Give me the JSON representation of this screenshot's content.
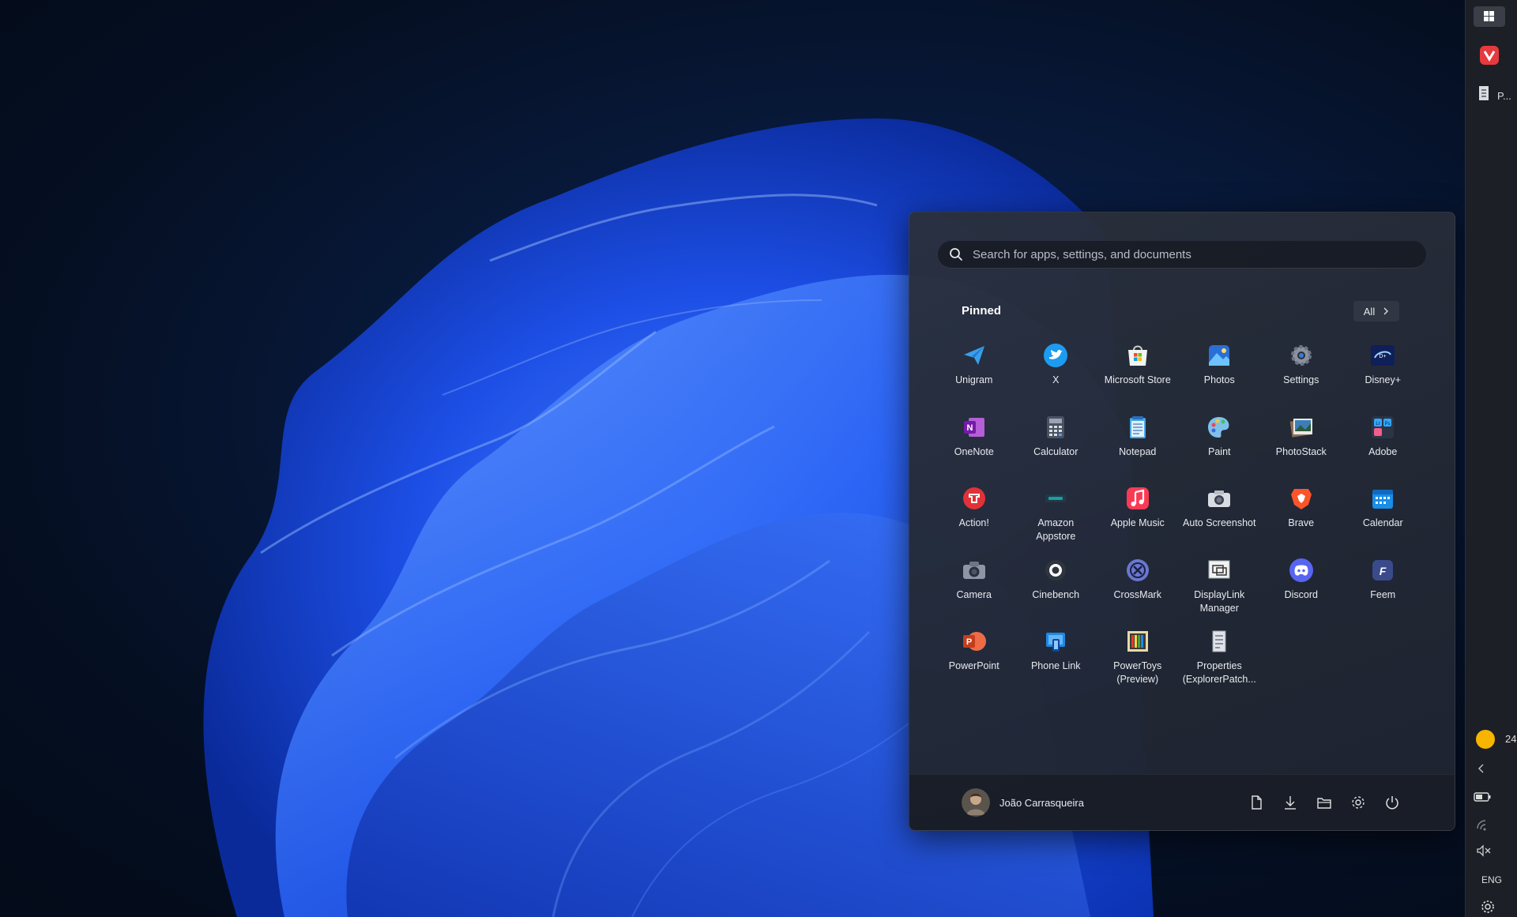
{
  "start_menu": {
    "search": {
      "placeholder": "Search for apps, settings, and documents"
    },
    "pinned_label": "Pinned",
    "all_button_label": "All",
    "apps": [
      {
        "id": "unigram",
        "label": "Unigram",
        "icon": "unigram-icon"
      },
      {
        "id": "x",
        "label": "X",
        "icon": "x-twitter-icon"
      },
      {
        "id": "microsoft-store",
        "label": "Microsoft Store",
        "icon": "microsoft-store-icon"
      },
      {
        "id": "photos",
        "label": "Photos",
        "icon": "photos-icon"
      },
      {
        "id": "settings",
        "label": "Settings",
        "icon": "settings-gear-icon"
      },
      {
        "id": "disney",
        "label": "Disney+",
        "icon": "disney-plus-icon"
      },
      {
        "id": "onenote",
        "label": "OneNote",
        "icon": "onenote-icon"
      },
      {
        "id": "calculator",
        "label": "Calculator",
        "icon": "calculator-icon"
      },
      {
        "id": "notepad",
        "label": "Notepad",
        "icon": "notepad-icon"
      },
      {
        "id": "paint",
        "label": "Paint",
        "icon": "paint-palette-icon"
      },
      {
        "id": "photostack",
        "label": "PhotoStack",
        "icon": "photostack-icon"
      },
      {
        "id": "adobe",
        "label": "Adobe",
        "icon": "adobe-folder-icon"
      },
      {
        "id": "action",
        "label": "Action!",
        "icon": "action-icon"
      },
      {
        "id": "amazon-appstore",
        "label": "Amazon\nAppstore",
        "icon": "amazon-appstore-icon"
      },
      {
        "id": "apple-music",
        "label": "Apple Music",
        "icon": "apple-music-icon"
      },
      {
        "id": "auto-screenshot",
        "label": "Auto Screenshot",
        "icon": "camera-screenshot-icon"
      },
      {
        "id": "brave",
        "label": "Brave",
        "icon": "brave-lion-icon"
      },
      {
        "id": "calendar",
        "label": "Calendar",
        "icon": "calendar-icon"
      },
      {
        "id": "camera",
        "label": "Camera",
        "icon": "camera-icon"
      },
      {
        "id": "cinebench",
        "label": "Cinebench",
        "icon": "cinebench-icon"
      },
      {
        "id": "crossmark",
        "label": "CrossMark",
        "icon": "crossmark-icon"
      },
      {
        "id": "displaylink",
        "label": "DisplayLink\nManager",
        "icon": "displaylink-icon"
      },
      {
        "id": "discord",
        "label": "Discord",
        "icon": "discord-icon"
      },
      {
        "id": "feem",
        "label": "Feem",
        "icon": "feem-icon"
      },
      {
        "id": "powerpoint",
        "label": "PowerPoint",
        "icon": "powerpoint-icon"
      },
      {
        "id": "phone-link",
        "label": "Phone Link",
        "icon": "phone-link-icon"
      },
      {
        "id": "powertoys",
        "label": "PowerToys\n(Preview)",
        "icon": "powertoys-icon"
      },
      {
        "id": "properties",
        "label": "Properties\n(ExplorerPatch...",
        "icon": "properties-icon"
      }
    ],
    "user": {
      "name": "João Carrasqueira",
      "icon": "user-avatar"
    },
    "footer_buttons": [
      "documents-icon",
      "downloads-icon",
      "file-explorer-icon",
      "settings-icon",
      "power-icon"
    ]
  },
  "taskbar": {
    "start_icon": "windows-logo-icon",
    "pinned": [
      "vivaldi-icon",
      "properties-window-icon"
    ],
    "window_label": "P...",
    "weather": {
      "icon": "weather-sun-icon",
      "temp": "24"
    },
    "tray_icons": [
      "chevron-left-icon",
      "battery-icon",
      "wifi-icon",
      "volume-muted-icon"
    ],
    "language": "ENG",
    "settings_icon": "settings-gear-icon"
  },
  "colors": {
    "menu_bg": "#262c38",
    "taskbar_bg": "#1c1f25",
    "wallpaper_accent": "#1f5cff"
  }
}
